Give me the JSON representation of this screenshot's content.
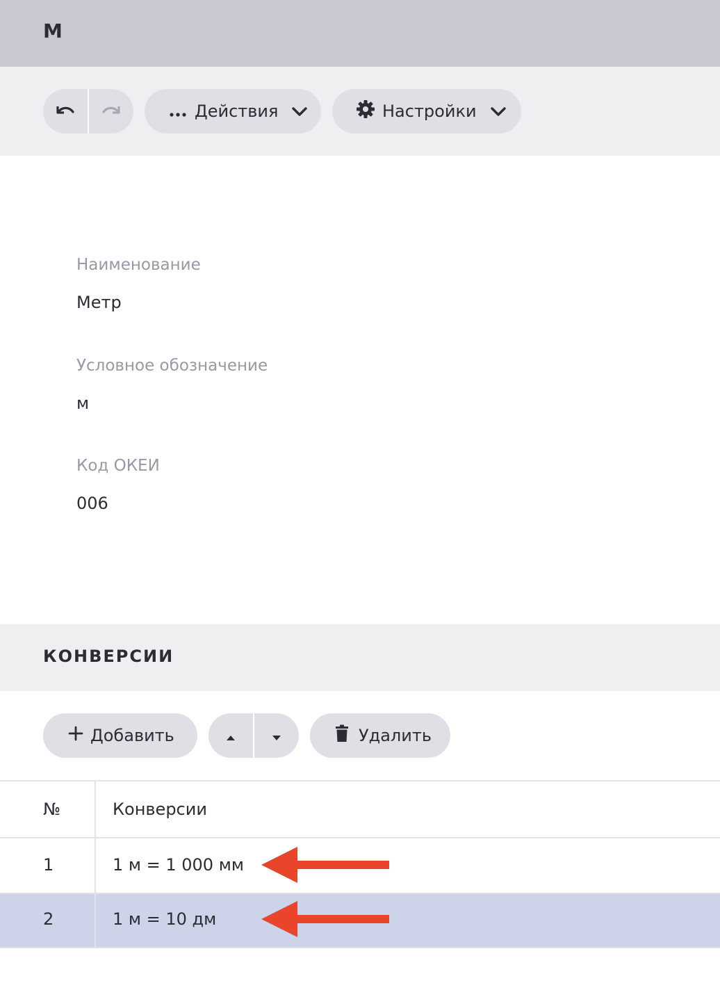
{
  "window": {
    "title": "М"
  },
  "toolbar": {
    "undo_icon": "undo-icon",
    "redo_icon": "redo-icon",
    "actions_label": "Действия",
    "settings_label": "Настройки"
  },
  "form": {
    "name_label": "Наименование",
    "name_value": "Метр",
    "symbol_label": "Условное обозначение",
    "symbol_value": "м",
    "okei_label": "Код ОКЕИ",
    "okei_value": "006"
  },
  "conversions": {
    "section_title": "КОНВЕРСИИ",
    "add_label": "Добавить",
    "delete_label": "Удалить",
    "columns": [
      "№",
      "Конверсии"
    ],
    "rows": [
      {
        "num": "1",
        "conversion": "1 м = 1 000 мм",
        "selected": false
      },
      {
        "num": "2",
        "conversion": "1 м = 10 дм",
        "selected": true
      }
    ]
  },
  "colors": {
    "accent_arrow": "#e8452a",
    "selected_row": "#cdd3e8",
    "title_bar": "#c9c7d1"
  }
}
